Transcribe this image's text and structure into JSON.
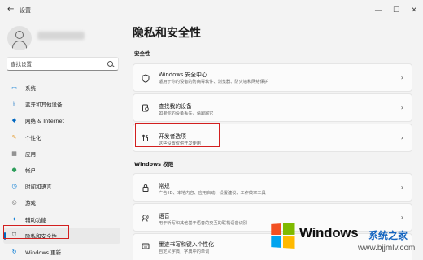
{
  "window": {
    "back_icon": "back-arrow-icon",
    "title": "设置",
    "controls": [
      "minimize-icon",
      "maximize-icon",
      "close-icon"
    ]
  },
  "sidebar": {
    "search_placeholder": "查找设置",
    "items": [
      {
        "label": "系统",
        "icon": "monitor-icon",
        "color": "#0078d4"
      },
      {
        "label": "蓝牙和其他设备",
        "icon": "bluetooth-icon",
        "color": "#0067c0"
      },
      {
        "label": "网络 & Internet",
        "icon": "wifi-icon",
        "color": "#0067c0"
      },
      {
        "label": "个性化",
        "icon": "brush-icon",
        "color": "#e6a23c"
      },
      {
        "label": "应用",
        "icon": "apps-icon",
        "color": "#5b5b5b"
      },
      {
        "label": "帐户",
        "icon": "account-icon",
        "color": "#2e9e5b"
      },
      {
        "label": "时间和语言",
        "icon": "clock-globe-icon",
        "color": "#0078d4"
      },
      {
        "label": "游戏",
        "icon": "gamepad-icon",
        "color": "#5b5b5b"
      },
      {
        "label": "辅助功能",
        "icon": "accessibility-icon",
        "color": "#0078d4"
      },
      {
        "label": "隐私和安全性",
        "icon": "shield-icon",
        "color": "#5b5b5b",
        "active": true
      },
      {
        "label": "Windows 更新",
        "icon": "update-icon",
        "color": "#0078d4"
      }
    ]
  },
  "main": {
    "title": "隐私和安全性",
    "security_section_label": "安全性",
    "windows_permissions_label": "Windows 权限",
    "cards": [
      {
        "title": "Windows 安全中心",
        "desc": "适用于你的设备的防病毒软件、浏览器、防火墙和网络保护",
        "icon": "shield-outline-icon"
      },
      {
        "title": "查找我的设备",
        "desc": "如果你的设备丢失，请跟踪它",
        "icon": "find-device-icon"
      },
      {
        "title": "开发者选项",
        "desc": "这些设置仅供开发使用",
        "icon": "developer-tools-icon"
      },
      {
        "title": "常规",
        "desc": "广告 ID、本地内容、应用启动、设置建议、工作效率工具",
        "icon": "lock-icon"
      },
      {
        "title": "语音",
        "desc": "用于听写和其他基于语音的交互的联机语音识别",
        "icon": "speech-icon"
      },
      {
        "title": "墨迹书写和键入个性化",
        "desc": "自定义字典，字典中的单词",
        "icon": "keyboard-pen-icon"
      }
    ]
  },
  "watermark": {
    "title": "Windows",
    "cn": "系统之家",
    "url": "www.bjjmlv.com",
    "logo_colors": [
      "#f25022",
      "#7fba00",
      "#00a4ef",
      "#ffb900"
    ]
  }
}
